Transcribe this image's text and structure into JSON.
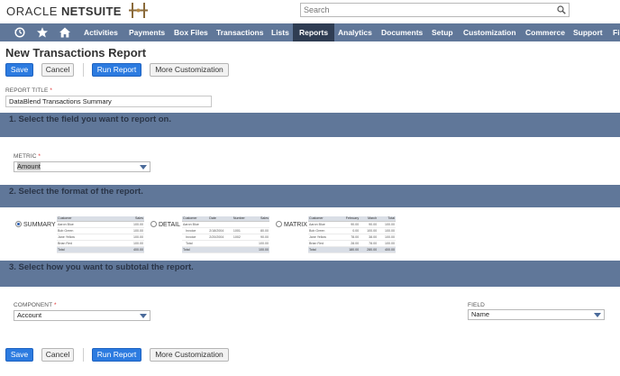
{
  "header": {
    "logo_oracle": "ORACLE",
    "logo_netsuite": "NETSUITE",
    "search_placeholder": "Search"
  },
  "nav": {
    "items": [
      "Activities",
      "Payments",
      "Box Files",
      "Transactions",
      "Lists",
      "Reports",
      "Analytics",
      "Documents",
      "Setup",
      "Customization",
      "Commerce",
      "Support",
      "Fi"
    ],
    "active": "Reports"
  },
  "page": {
    "title": "New Transactions Report"
  },
  "toolbar": {
    "save": "Save",
    "cancel": "Cancel",
    "run_report": "Run Report",
    "more_customization": "More Customization"
  },
  "report_title": {
    "label": "REPORT TITLE",
    "required_mark": "*",
    "value": "DataBlend Transactions Summary"
  },
  "section1": {
    "title": "1. Select the field you want to report on."
  },
  "metric": {
    "label": "METRIC",
    "required_mark": "*",
    "value": "Amount"
  },
  "section2": {
    "title": "2. Select the format of the report."
  },
  "formats": {
    "summary": {
      "label": "SUMMARY",
      "selected": true,
      "headers": [
        "Customer",
        "Sales"
      ],
      "rows": [
        [
          "Aaron Blue",
          "100.00"
        ],
        [
          "Bob Green",
          "100.00"
        ],
        [
          "Jane Yellow",
          "100.00"
        ],
        [
          "Brian Red",
          "100.00"
        ]
      ],
      "total": [
        "Total",
        "400.00"
      ]
    },
    "detail": {
      "label": "DETAIL",
      "selected": false,
      "headers": [
        "Customer",
        "Date",
        "Number",
        "Sales"
      ],
      "rows": [
        [
          "Aaron Blue",
          "",
          "",
          ""
        ],
        [
          "Invoice",
          "2/18/2004",
          "1001",
          "80.00"
        ],
        [
          "Invoice",
          "2/20/2004",
          "1002",
          "90.00"
        ],
        [
          "Total",
          "",
          "",
          "100.00"
        ]
      ],
      "total": [
        "Total",
        "",
        "",
        "100.00"
      ]
    },
    "matrix": {
      "label": "MATRIX",
      "selected": false,
      "headers": [
        "Customer",
        "February",
        "March",
        "Total"
      ],
      "rows": [
        [
          "Aaron Blue",
          "90.00",
          "90.00",
          "100.00"
        ],
        [
          "Bob Green",
          "0.00",
          "100.00",
          "100.00"
        ],
        [
          "Jane Yellow",
          "78.00",
          "38.00",
          "100.00"
        ],
        [
          "Brian Red",
          "28.00",
          "78.00",
          "100.00"
        ]
      ],
      "total": [
        "Total",
        "180.00",
        "280.00",
        "400.00"
      ]
    }
  },
  "section3": {
    "title": "3. Select how you want to subtotal the report."
  },
  "component": {
    "label": "COMPONENT",
    "required_mark": "*",
    "value": "Account"
  },
  "field": {
    "label": "FIELD",
    "value": "Name"
  },
  "colors": {
    "nav_bg": "#607799",
    "nav_active": "#2f3d53",
    "section_bg": "#607799",
    "primary_button": "#2c7be0"
  }
}
